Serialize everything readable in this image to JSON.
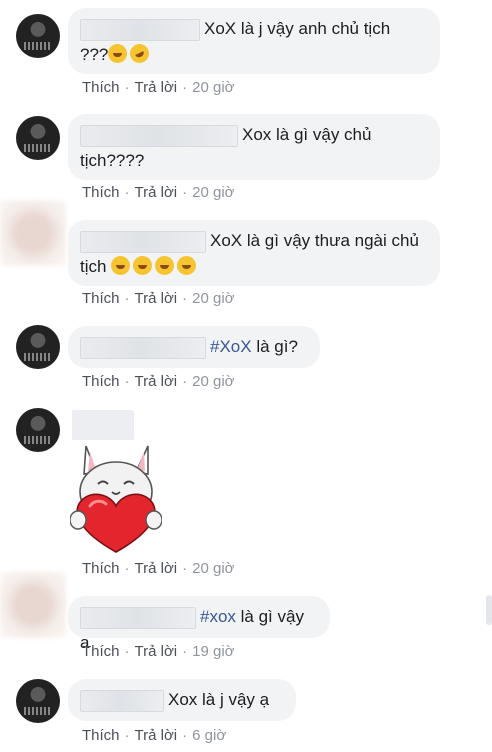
{
  "actions": {
    "like": "Thích",
    "reply": "Trả lời"
  },
  "comments": [
    {
      "text": "XoX là j vậy anh chủ tịch",
      "line2": "???",
      "time": "20 giờ"
    },
    {
      "text": "Xox là gì vậy chủ",
      "line2": "tịch????",
      "time": "20 giờ"
    },
    {
      "text": "XoX là gì vậy thưa ngài chủ",
      "line2": "tịch",
      "time": "20 giờ"
    },
    {
      "hashtag": "#XoX",
      "text": " là gì?",
      "time": "20 giờ"
    },
    {
      "time": "20 giờ"
    },
    {
      "hashtag": "#xox",
      "text": " là gì vậy a",
      "time": "19 giờ"
    },
    {
      "text": "Xox là j vậy ạ",
      "time": "6 giờ"
    }
  ],
  "icons": [
    "laughing-emoji",
    "rofl-emoji",
    "heart-sticker",
    "avatar"
  ]
}
